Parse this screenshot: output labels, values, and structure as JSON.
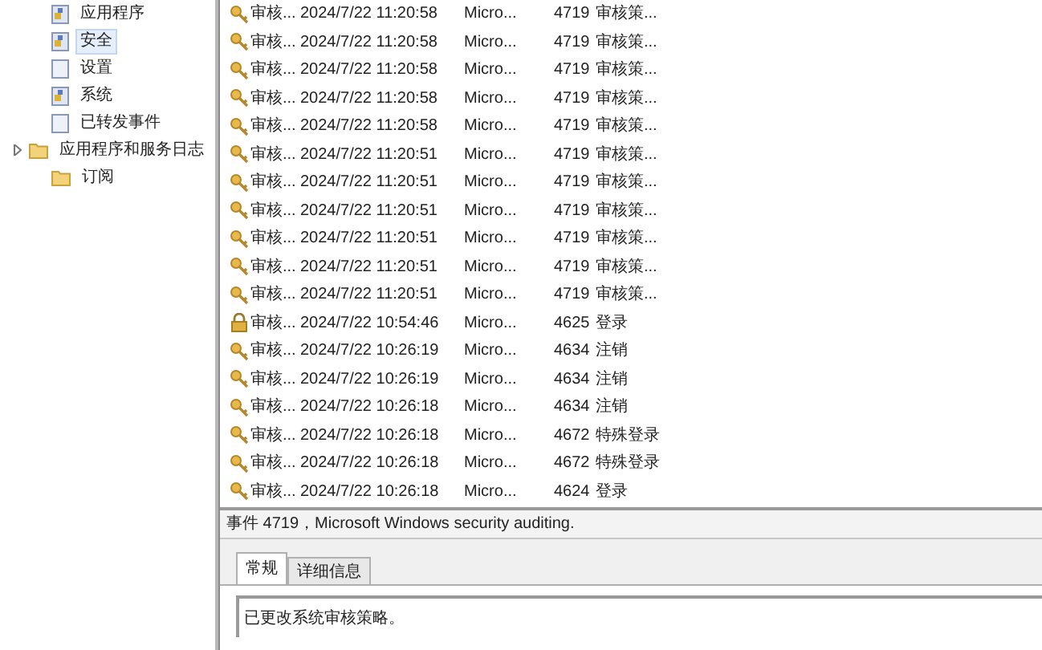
{
  "tree": {
    "items": [
      {
        "label": "应用程序",
        "kind": "log",
        "selected": false
      },
      {
        "label": "安全",
        "kind": "log",
        "selected": true
      },
      {
        "label": "设置",
        "kind": "page",
        "selected": false
      },
      {
        "label": "系统",
        "kind": "log",
        "selected": false
      },
      {
        "label": "已转发事件",
        "kind": "page",
        "selected": false
      },
      {
        "label": "应用程序和服务日志",
        "kind": "folder",
        "selected": false,
        "expanded": false
      },
      {
        "label": "订阅",
        "kind": "folder",
        "selected": false
      }
    ]
  },
  "events": {
    "rows": [
      {
        "kind": "key",
        "level": "审核...",
        "date": "2024/7/22 11:20:58",
        "source": "Micro...",
        "id": "4719",
        "task": "审核策..."
      },
      {
        "kind": "key",
        "level": "审核...",
        "date": "2024/7/22 11:20:58",
        "source": "Micro...",
        "id": "4719",
        "task": "审核策..."
      },
      {
        "kind": "key",
        "level": "审核...",
        "date": "2024/7/22 11:20:58",
        "source": "Micro...",
        "id": "4719",
        "task": "审核策..."
      },
      {
        "kind": "key",
        "level": "审核...",
        "date": "2024/7/22 11:20:58",
        "source": "Micro...",
        "id": "4719",
        "task": "审核策..."
      },
      {
        "kind": "key",
        "level": "审核...",
        "date": "2024/7/22 11:20:58",
        "source": "Micro...",
        "id": "4719",
        "task": "审核策..."
      },
      {
        "kind": "key",
        "level": "审核...",
        "date": "2024/7/22 11:20:51",
        "source": "Micro...",
        "id": "4719",
        "task": "审核策..."
      },
      {
        "kind": "key",
        "level": "审核...",
        "date": "2024/7/22 11:20:51",
        "source": "Micro...",
        "id": "4719",
        "task": "审核策..."
      },
      {
        "kind": "key",
        "level": "审核...",
        "date": "2024/7/22 11:20:51",
        "source": "Micro...",
        "id": "4719",
        "task": "审核策..."
      },
      {
        "kind": "key",
        "level": "审核...",
        "date": "2024/7/22 11:20:51",
        "source": "Micro...",
        "id": "4719",
        "task": "审核策..."
      },
      {
        "kind": "key",
        "level": "审核...",
        "date": "2024/7/22 11:20:51",
        "source": "Micro...",
        "id": "4719",
        "task": "审核策..."
      },
      {
        "kind": "key",
        "level": "审核...",
        "date": "2024/7/22 11:20:51",
        "source": "Micro...",
        "id": "4719",
        "task": "审核策..."
      },
      {
        "kind": "lock",
        "level": "审核...",
        "date": "2024/7/22 10:54:46",
        "source": "Micro...",
        "id": "4625",
        "task": "登录"
      },
      {
        "kind": "key",
        "level": "审核...",
        "date": "2024/7/22 10:26:19",
        "source": "Micro...",
        "id": "4634",
        "task": "注销"
      },
      {
        "kind": "key",
        "level": "审核...",
        "date": "2024/7/22 10:26:19",
        "source": "Micro...",
        "id": "4634",
        "task": "注销"
      },
      {
        "kind": "key",
        "level": "审核...",
        "date": "2024/7/22 10:26:18",
        "source": "Micro...",
        "id": "4634",
        "task": "注销"
      },
      {
        "kind": "key",
        "level": "审核...",
        "date": "2024/7/22 10:26:18",
        "source": "Micro...",
        "id": "4672",
        "task": "特殊登录"
      },
      {
        "kind": "key",
        "level": "审核...",
        "date": "2024/7/22 10:26:18",
        "source": "Micro...",
        "id": "4672",
        "task": "特殊登录"
      },
      {
        "kind": "key",
        "level": "审核...",
        "date": "2024/7/22 10:26:18",
        "source": "Micro...",
        "id": "4624",
        "task": "登录"
      }
    ]
  },
  "detail": {
    "title": "事件 4719，Microsoft Windows security auditing.",
    "tabs": [
      {
        "label": "常规",
        "selected": true
      },
      {
        "label": "详细信息",
        "selected": false
      }
    ],
    "message": "已更改系统审核策略。"
  }
}
